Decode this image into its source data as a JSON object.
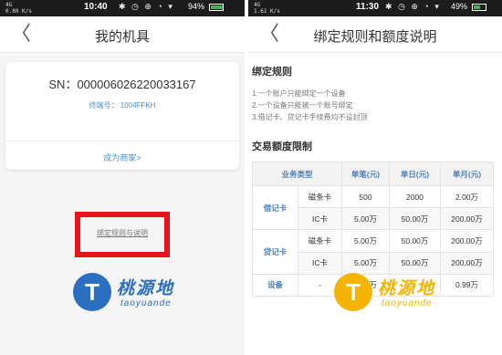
{
  "colors": {
    "accent_blue": "#4a90c4",
    "highlight_red": "#e8141b",
    "statusbar": "#1c1c1c",
    "logo_blue": "#2a6fc0",
    "logo_yellow": "#f5b400"
  },
  "left_screen": {
    "statusbar": {
      "signal": "4G\n0.80 K/s",
      "time": "10:40",
      "icons": "✱ ◷ ⊕ ◔ ▾",
      "battery": "94%",
      "battery_level": 0.94
    },
    "navbar": {
      "back_icon": "chevron-left-icon",
      "back_glyph": "〈",
      "title": "我的机具"
    },
    "device_card": {
      "sn": "SN：000006026220033167",
      "terminal": "终端号：   1004FFKH",
      "merchant_link": "成为商家>"
    },
    "rules_link": "绑定规则与说明",
    "watermark": {
      "glyph": "T",
      "cn": "桃源地",
      "en": "taoyuande"
    }
  },
  "right_screen": {
    "statusbar": {
      "signal": "4G\n1.61 K/s",
      "time": "11:30",
      "icons": "✱ ◷ ⊕ ◔ ▾",
      "battery": "49%",
      "battery_level": 0.49
    },
    "navbar": {
      "back_icon": "chevron-left-icon",
      "back_glyph": "〈",
      "title": "绑定规则和额度说明"
    },
    "binding_rules": {
      "title": "绑定规则",
      "items": [
        "1.一个账户只能绑定一个设备",
        "2.一个设备只能被一个账号绑定",
        "3.借记卡、贷记卡手续费均不设封顶"
      ]
    },
    "limit_section": {
      "title": "交易额度限制",
      "headers": [
        "业务类型",
        "",
        "单笔(元)",
        "单日(元)",
        "单月(元)"
      ],
      "rows": [
        {
          "category": "借记卡",
          "card_type": "磁条卡",
          "single": "500",
          "daily": "2000",
          "monthly": "2.00万"
        },
        {
          "category": "",
          "card_type": "IC卡",
          "single": "5.00万",
          "daily": "50.00万",
          "monthly": "200.00万"
        },
        {
          "category": "贷记卡",
          "card_type": "磁条卡",
          "single": "5.00万",
          "daily": "50.00万",
          "monthly": "200.00万"
        },
        {
          "category": "",
          "card_type": "IC卡",
          "single": "5.00万",
          "daily": "50.00万",
          "monthly": "200.00万"
        },
        {
          "category": "设备",
          "card_type": "-",
          "single": "5.00万",
          "daily": "",
          "monthly": "0.99万"
        }
      ]
    },
    "watermark": {
      "glyph": "T",
      "cn": "桃源地",
      "en": "taoyuande"
    }
  }
}
